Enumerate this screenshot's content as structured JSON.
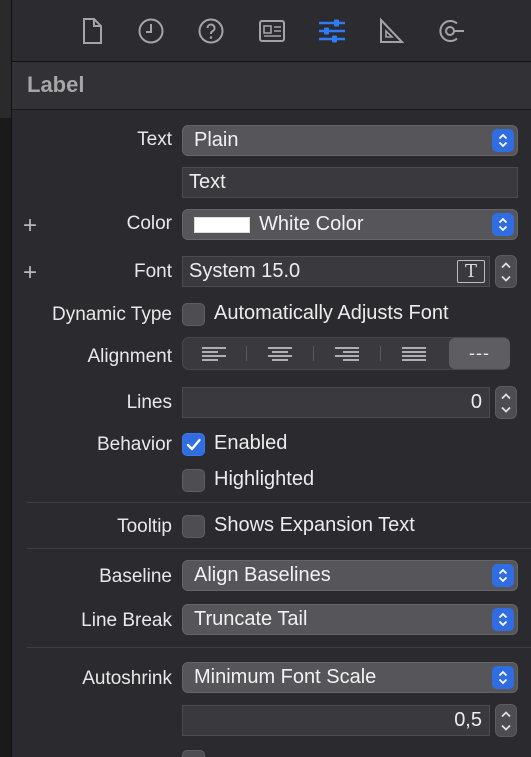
{
  "toolbar": {
    "icons": [
      "file-icon",
      "clock-icon",
      "help-icon",
      "identity-icon",
      "attributes-icon",
      "ruler-icon",
      "connections-icon"
    ],
    "accent": "#2f7cf6"
  },
  "section": {
    "title": "Label"
  },
  "fields": {
    "text_label": "Text",
    "text_type": "Plain",
    "text_value": "Text",
    "color_label": "Color",
    "color_value": "White Color",
    "font_label": "Font",
    "font_value": "System 15.0",
    "dynamic_type_label": "Dynamic Type",
    "dynamic_type_option": "Automatically Adjusts Font",
    "alignment_label": "Alignment",
    "alignment_natural": "---",
    "lines_label": "Lines",
    "lines_value": "0",
    "behavior_label": "Behavior",
    "enabled_label": "Enabled",
    "highlighted_label": "Highlighted",
    "tooltip_label": "Tooltip",
    "tooltip_option": "Shows Expansion Text",
    "baseline_label": "Baseline",
    "baseline_value": "Align Baselines",
    "line_break_label": "Line Break",
    "line_break_value": "Truncate Tail",
    "autoshrink_label": "Autoshrink",
    "autoshrink_value": "Minimum Font Scale",
    "scale_value": "0,5"
  },
  "colors": {
    "checkbox_checked": "#2f6de1",
    "swatch": "#ffffff"
  }
}
